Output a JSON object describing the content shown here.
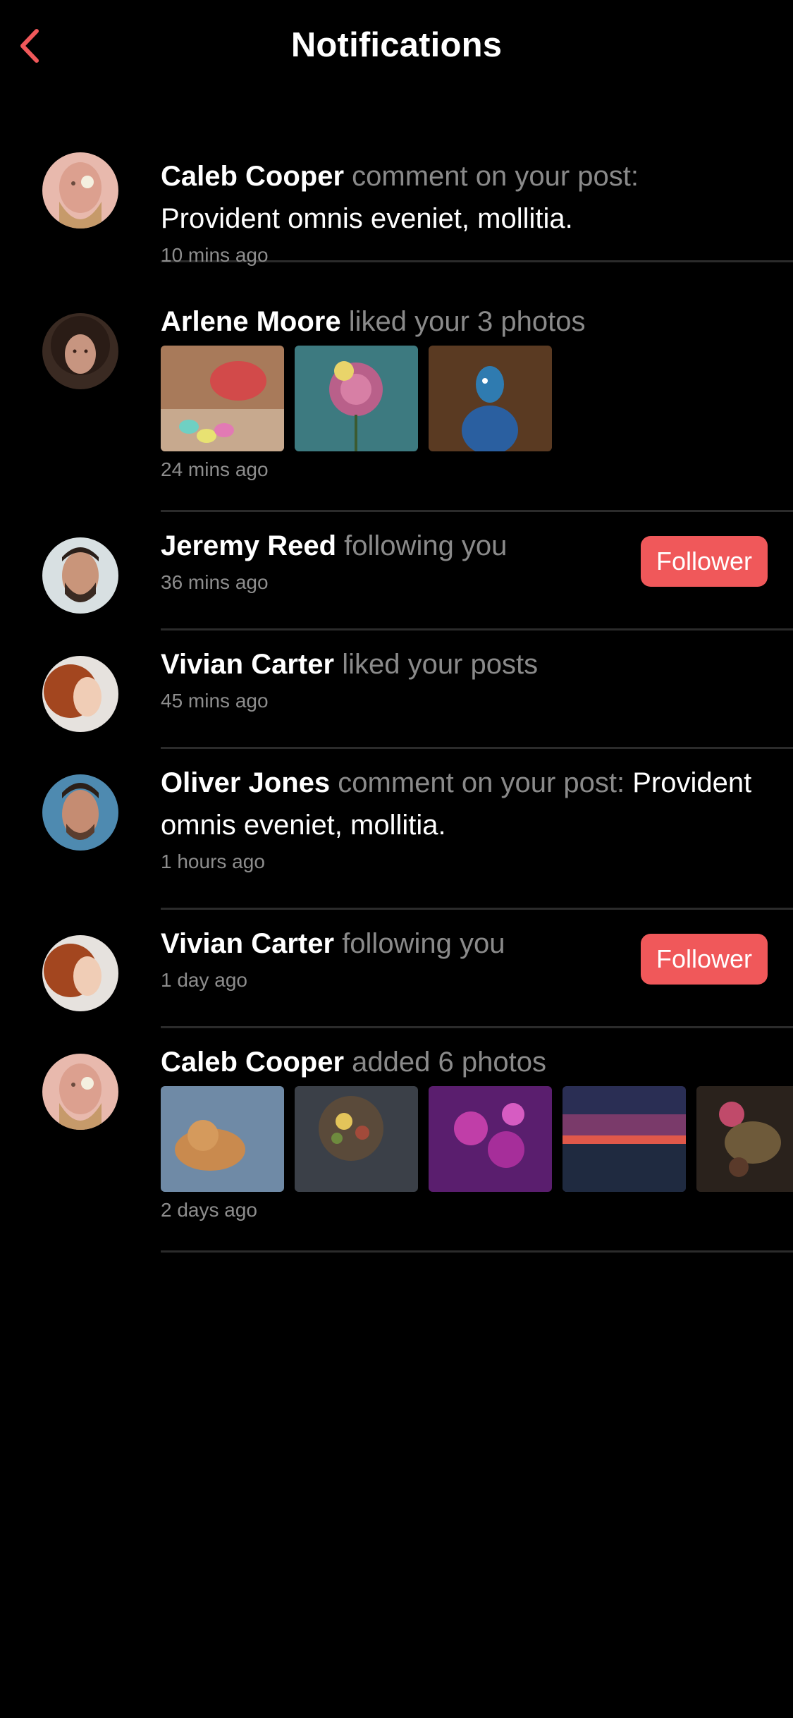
{
  "header": {
    "title": "Notifications",
    "back_icon": "chevron-left-icon",
    "accent_color": "#f0585a"
  },
  "notifications": [
    {
      "user": "Caleb Cooper",
      "action": "comment on your post:",
      "message": "Provident omnis eveniet, mollitia.",
      "time": "10 mins ago"
    },
    {
      "user": "Arlene Moore",
      "action": "liked your 3 photos",
      "time": "24 mins ago",
      "photos": [
        "macarons-photo",
        "rose-photo",
        "peacock-photo"
      ]
    },
    {
      "user": "Jeremy Reed",
      "action": "following you",
      "time": "36 mins ago",
      "button": "Follower"
    },
    {
      "user": "Vivian Carter",
      "action": "liked your posts",
      "time": "45 mins ago"
    },
    {
      "user": "Oliver Jones",
      "action": "comment on your post:",
      "message": "Provident omnis eveniet, mollitia.",
      "time": "1 hours ago"
    },
    {
      "user": "Vivian Carter",
      "action": "following you",
      "time": "1 day ago",
      "button": "Follower"
    },
    {
      "user": "Caleb Cooper",
      "action": "added 6 photos",
      "time": "2 days ago",
      "photos": [
        "cat-photo",
        "food-bowl-photo",
        "purple-flowers-photo",
        "sunset-photo",
        "chocolates-photo"
      ]
    }
  ]
}
